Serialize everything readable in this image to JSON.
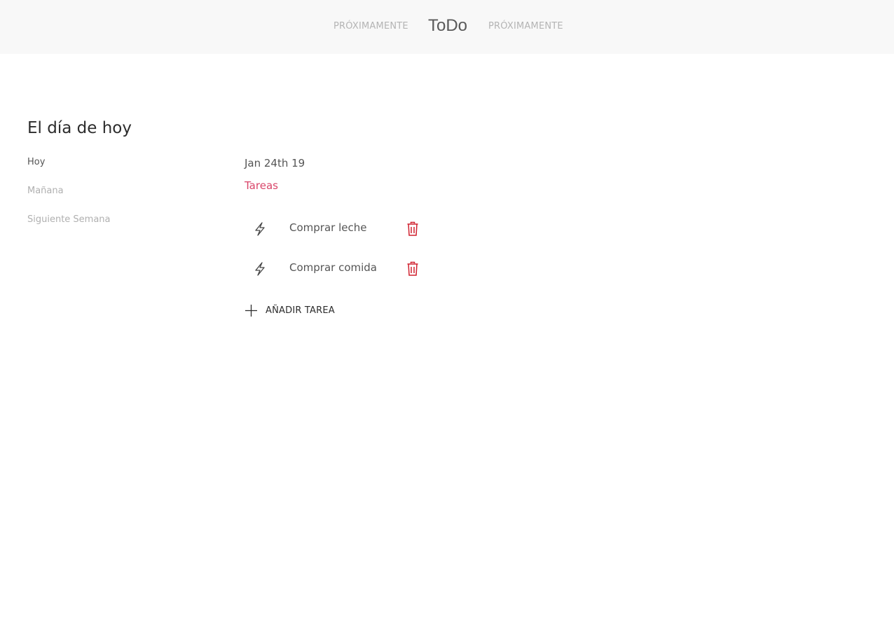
{
  "header": {
    "nav_left": "PRÓXIMAMENTE",
    "brand": "ToDo",
    "nav_right": "PRÓXIMAMENTE"
  },
  "page": {
    "title": "El día de hoy"
  },
  "sidebar": {
    "items": [
      {
        "label": "Hoy",
        "active": true
      },
      {
        "label": "Mañana",
        "active": false
      },
      {
        "label": "Siguiente Semana",
        "active": false
      }
    ]
  },
  "main": {
    "date": "Jan 24th 19",
    "section_label": "Tareas",
    "tasks": [
      {
        "text": "Comprar leche",
        "icon": "lightning-icon",
        "delete_icon": "trash-icon"
      },
      {
        "text": "Comprar comida",
        "icon": "lightning-icon",
        "delete_icon": "trash-icon"
      }
    ],
    "add_task_label": "AÑADIR TAREA"
  },
  "colors": {
    "topbar_bg": "#f8f8f8",
    "accent": "#d9466a",
    "delete": "#d0202e",
    "muted": "#b0b0b0",
    "text": "#555555"
  }
}
